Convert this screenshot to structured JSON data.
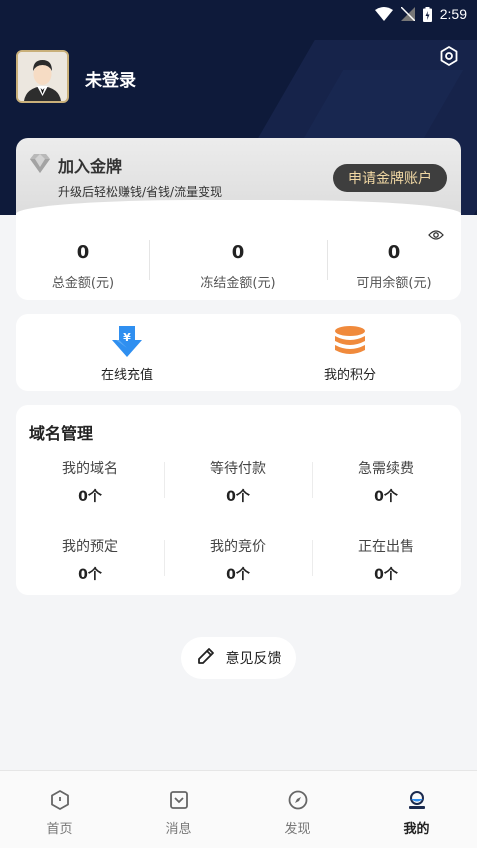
{
  "status_bar": {
    "time": "2:59"
  },
  "profile": {
    "login_label": "未登录"
  },
  "gold_banner": {
    "title": "加入金牌",
    "subtitle": "升级后轻松赚钱/省钱/流量变现",
    "apply_button": "申请金牌账户"
  },
  "balances": [
    {
      "value": "0",
      "label": "总金额(元)"
    },
    {
      "value": "0",
      "label": "冻结金额(元)"
    },
    {
      "value": "0",
      "label": "可用余额(元)"
    }
  ],
  "quick_actions": [
    {
      "label": "在线充值",
      "icon": "yuan-download-icon"
    },
    {
      "label": "我的积分",
      "icon": "coin-stack-icon"
    }
  ],
  "domain_management": {
    "title": "域名管理",
    "items": [
      {
        "label": "我的域名",
        "value": "0个"
      },
      {
        "label": "等待付款",
        "value": "0个"
      },
      {
        "label": "急需续费",
        "value": "0个"
      },
      {
        "label": "我的预定",
        "value": "0个"
      },
      {
        "label": "我的竞价",
        "value": "0个"
      },
      {
        "label": "正在出售",
        "value": "0个"
      }
    ]
  },
  "feedback": {
    "label": "意见反馈"
  },
  "tabbar": [
    {
      "label": "首页",
      "icon": "home-icon",
      "active": false
    },
    {
      "label": "消息",
      "icon": "message-icon",
      "active": false
    },
    {
      "label": "发现",
      "icon": "compass-icon",
      "active": false
    },
    {
      "label": "我的",
      "icon": "profile-icon",
      "active": true
    }
  ],
  "colors": {
    "header_bg": "#0e1a3a",
    "gold_text": "#f1d8a4",
    "recharge_blue": "#2f8ff0",
    "points_orange": "#f08a3c"
  }
}
